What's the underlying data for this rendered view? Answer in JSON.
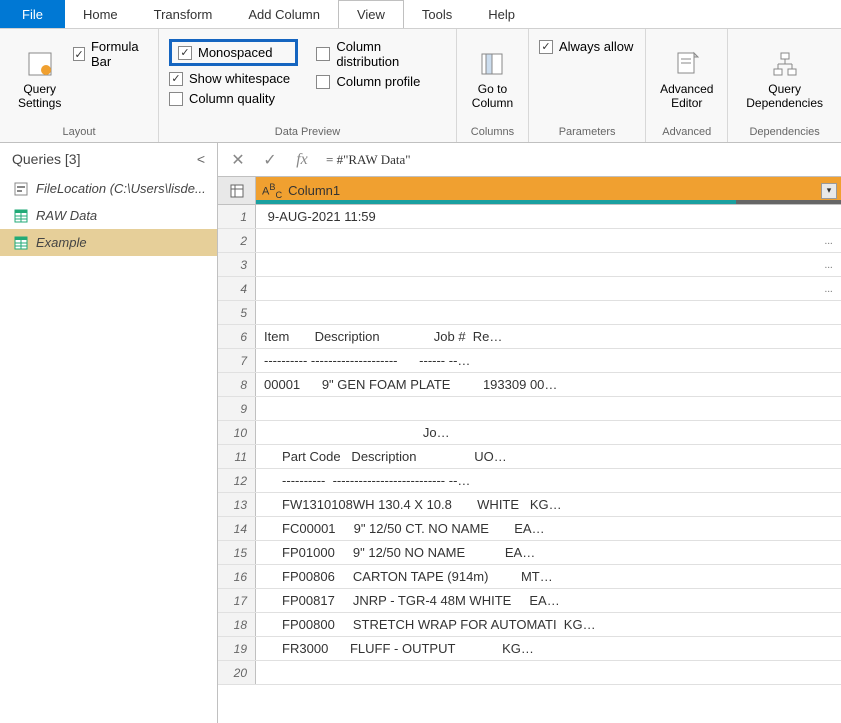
{
  "menu": {
    "file": "File",
    "items": [
      "Home",
      "Transform",
      "Add Column",
      "View",
      "Tools",
      "Help"
    ],
    "active": "View"
  },
  "ribbon": {
    "layout": {
      "label": "Layout",
      "query_settings": "Query\nSettings",
      "formula_bar": "Formula Bar"
    },
    "data_preview": {
      "label": "Data Preview",
      "monospaced": "Monospaced",
      "show_whitespace": "Show whitespace",
      "column_quality": "Column quality",
      "column_distribution": "Column distribution",
      "column_profile": "Column profile"
    },
    "columns": {
      "label": "Columns",
      "goto": "Go to\nColumn"
    },
    "parameters": {
      "label": "Parameters",
      "always_allow": "Always allow"
    },
    "advanced": {
      "label": "Advanced",
      "editor": "Advanced\nEditor"
    },
    "dependencies": {
      "label": "Dependencies",
      "query": "Query\nDependencies"
    }
  },
  "queries": {
    "header": "Queries [3]",
    "items": [
      {
        "label": "FileLocation (C:\\Users\\lisde...",
        "type": "param"
      },
      {
        "label": "RAW Data",
        "type": "table"
      },
      {
        "label": "Example",
        "type": "table",
        "selected": true
      }
    ]
  },
  "formula": "= #\"RAW Data\"",
  "grid": {
    "column": "Column1",
    "rows": [
      {
        "n": 1,
        "text": " 9-AUG-2021 11:59",
        "right": ""
      },
      {
        "n": 2,
        "text": "",
        "right": "..."
      },
      {
        "n": 3,
        "text": "",
        "right": "..."
      },
      {
        "n": 4,
        "text": "",
        "right": "..."
      },
      {
        "n": 5,
        "text": "",
        "right": ""
      },
      {
        "n": 6,
        "text": "Item       Description               Job #  Re…",
        "right": ""
      },
      {
        "n": 7,
        "text": "---------- --------------------      ------ --…",
        "right": ""
      },
      {
        "n": 8,
        "text": "00001      9\" GEN FOAM PLATE         193309 00…",
        "right": ""
      },
      {
        "n": 9,
        "text": "",
        "right": ""
      },
      {
        "n": 10,
        "text": "                                            Jo…",
        "right": ""
      },
      {
        "n": 11,
        "text": "     Part Code   Description                UO…",
        "right": ""
      },
      {
        "n": 12,
        "text": "     ----------  -------------------------- --…",
        "right": ""
      },
      {
        "n": 13,
        "text": "     FW1310108WH 130.4 X 10.8       WHITE   KG…",
        "right": ""
      },
      {
        "n": 14,
        "text": "     FC00001     9\" 12/50 CT. NO NAME       EA…",
        "right": ""
      },
      {
        "n": 15,
        "text": "     FP01000     9\" 12/50 NO NAME           EA…",
        "right": ""
      },
      {
        "n": 16,
        "text": "     FP00806     CARTON TAPE (914m)         MT…",
        "right": ""
      },
      {
        "n": 17,
        "text": "     FP00817     JNRP - TGR-4 48M WHITE     EA…",
        "right": ""
      },
      {
        "n": 18,
        "text": "     FP00800     STRETCH WRAP FOR AUTOMATI  KG…",
        "right": ""
      },
      {
        "n": 19,
        "text": "     FR3000      FLUFF - OUTPUT             KG…",
        "right": ""
      },
      {
        "n": 20,
        "text": "",
        "right": ""
      }
    ]
  }
}
